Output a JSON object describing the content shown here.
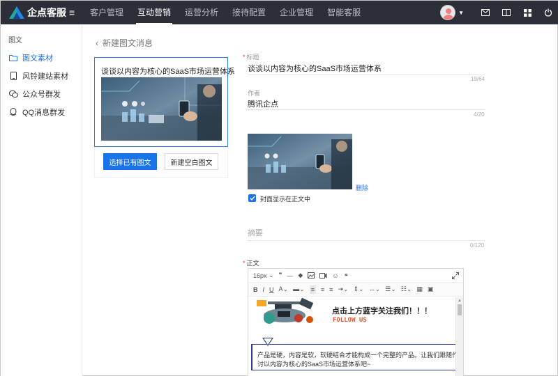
{
  "app": {
    "name": "企点客服"
  },
  "topnav": {
    "items": [
      {
        "label": "客户管理",
        "active": false
      },
      {
        "label": "互动营销",
        "active": true
      },
      {
        "label": "运营分析",
        "active": false
      },
      {
        "label": "接待配置",
        "active": false
      },
      {
        "label": "企业管理",
        "active": false
      },
      {
        "label": "智能客服",
        "active": false
      }
    ],
    "right_icons": [
      "mail-icon",
      "book-icon",
      "grid-icon",
      "logout-icon"
    ]
  },
  "sidebar": {
    "section": "图文",
    "items": [
      {
        "label": "图文素材",
        "icon": "folder-icon",
        "active": true
      },
      {
        "label": "风铃建站素材",
        "icon": "mobile-icon",
        "active": false
      },
      {
        "label": "公众号群发",
        "icon": "wechat-icon",
        "active": false
      },
      {
        "label": "QQ消息群发",
        "icon": "qq-icon",
        "active": false
      }
    ]
  },
  "page": {
    "back_label": "新建图文消息"
  },
  "article_card": {
    "title": "谈谈以内容为核心的SaaS市场运营体系",
    "select_button": "选择已有图文",
    "new_button": "新建空白图文"
  },
  "form": {
    "title": {
      "label": "标题",
      "required": true,
      "value": "谈谈以内容为核心的SaaS市场运营体系",
      "count": "19/64"
    },
    "author": {
      "label": "作者",
      "value": "腾讯企点",
      "count": "4/20"
    },
    "cover": {
      "delete_label": "删除",
      "show_in_body_label": "封面显示在正文中",
      "show_in_body": true
    },
    "summary": {
      "placeholder": "摘要",
      "count": "0/120"
    },
    "body": {
      "label": "正文",
      "required": true
    }
  },
  "editor": {
    "font_size": "16px",
    "promo_title": "点击上方蓝字关注我们！！！",
    "promo_follow": "FOLLOW US",
    "paragraph_line1": "产品是硬，内容是软，软硬结合才能构成一个完整的产品。让我们跟随作者",
    "paragraph_line2": "讨以内容为核心的SaaS市场运营体系吧~"
  },
  "colors": {
    "accent": "#1a73e8",
    "topbar": "#2d2f38",
    "promo_follow": "#e5542b",
    "text_box_border": "#2a3a8f"
  }
}
